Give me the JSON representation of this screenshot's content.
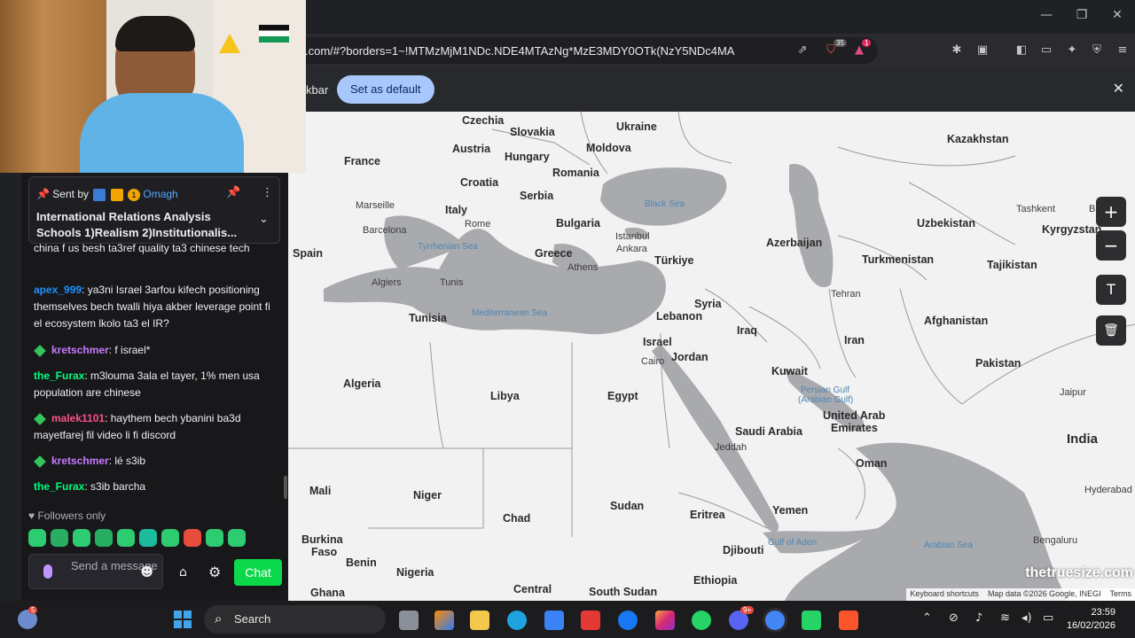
{
  "browser": {
    "url": ".com/#?borders=1~!MTMzMjM1NDc.NDE4MTAzNg*MzE3MDY0OTk(NzY5NDc4MA",
    "infobar_text": "kbar",
    "set_default_label": "Set as default",
    "extension_badges": [
      "35",
      "1"
    ]
  },
  "map": {
    "countries": [
      {
        "name": "Czechia"
      },
      {
        "name": "Ukraine"
      },
      {
        "name": "Slovakia"
      },
      {
        "name": "Moldova"
      },
      {
        "name": "Austria"
      },
      {
        "name": "Hungary"
      },
      {
        "name": "France"
      },
      {
        "name": "Romania"
      },
      {
        "name": "Kazakhstan"
      },
      {
        "name": "Croatia"
      },
      {
        "name": "Serbia"
      },
      {
        "name": "Italy"
      },
      {
        "name": "Bulgaria"
      },
      {
        "name": "Uzbekistan"
      },
      {
        "name": "Kyrgyzstan"
      },
      {
        "name": "Azerbaijan"
      },
      {
        "name": "Spain"
      },
      {
        "name": "Greece"
      },
      {
        "name": "Türkiye"
      },
      {
        "name": "Turkmenistan"
      },
      {
        "name": "Tajikistan"
      },
      {
        "name": "Tunisia"
      },
      {
        "name": "Syria"
      },
      {
        "name": "Lebanon"
      },
      {
        "name": "Iraq"
      },
      {
        "name": "Afghanistan"
      },
      {
        "name": "Israel"
      },
      {
        "name": "Iran"
      },
      {
        "name": "Jordan"
      },
      {
        "name": "Kuwait"
      },
      {
        "name": "Pakistan"
      },
      {
        "name": "Algeria"
      },
      {
        "name": "Libya"
      },
      {
        "name": "Egypt"
      },
      {
        "name": "United Arab"
      },
      {
        "name": "Emirates"
      },
      {
        "name": "Saudi Arabia"
      },
      {
        "name": "India"
      },
      {
        "name": "Oman"
      },
      {
        "name": "Mali"
      },
      {
        "name": "Niger"
      },
      {
        "name": "Chad"
      },
      {
        "name": "Sudan"
      },
      {
        "name": "Eritrea"
      },
      {
        "name": "Yemen"
      },
      {
        "name": "Burkina"
      },
      {
        "name": "Faso"
      },
      {
        "name": "Benin"
      },
      {
        "name": "Nigeria"
      },
      {
        "name": "Djibouti"
      },
      {
        "name": "Ethiopia"
      },
      {
        "name": "Ghana"
      },
      {
        "name": "Central"
      },
      {
        "name": "South Sudan"
      }
    ],
    "cities": [
      {
        "name": "Marseille"
      },
      {
        "name": "Rome"
      },
      {
        "name": "Barcelona"
      },
      {
        "name": "Istanbul"
      },
      {
        "name": "Ankara"
      },
      {
        "name": "Athens"
      },
      {
        "name": "Algiers"
      },
      {
        "name": "Tunis"
      },
      {
        "name": "Tehran"
      },
      {
        "name": "Cairo"
      },
      {
        "name": "Jeddah"
      },
      {
        "name": "Jaipur"
      },
      {
        "name": "Hyderabad"
      },
      {
        "name": "Bengaluru"
      },
      {
        "name": "Tashkent"
      },
      {
        "name": "Bishkek"
      }
    ],
    "seas": [
      {
        "name": "Black Sea"
      },
      {
        "name": "Tyrrhenian Sea"
      },
      {
        "name": "Mediterranean Sea"
      },
      {
        "name": "Persian Gulf"
      },
      {
        "name": "(Arabian Gulf)"
      },
      {
        "name": "Gulf of Aden"
      },
      {
        "name": "Arabian Sea"
      }
    ],
    "controls": {
      "zoom_in": "+",
      "zoom_out": "−",
      "text_tool": "T"
    },
    "watermark": "thetruesize.com",
    "attribution": [
      "Keyboard shortcuts",
      "Map data ©2026 Google, INEGI",
      "Terms"
    ]
  },
  "chat": {
    "pinned": {
      "sent_by": "Sent by",
      "badge_count": "1",
      "user": "Omagh",
      "title": "International Relations Analysis Schools 1)Realism 2)Institutionalis..."
    },
    "messages": [
      {
        "user": "",
        "text": "china f us besh ta3ref quality ta3 chinese tech",
        "color": "#efeff1",
        "sub": false
      },
      {
        "user": "apex_999",
        "text": ": ya3ni Israel 3arfou kifech positioning themselves bech twalli hiya akber leverage point fi el ecosystem lkolo ta3 el IR?",
        "color": "#1e90ff",
        "sub": false
      },
      {
        "user": "kretschmer",
        "text": ": f israel*",
        "color": "#c879ff",
        "sub": true
      },
      {
        "user": "the_Furax",
        "text": ": m3louma 3ala el tayer, 1% men usa population are chinese",
        "color": "#00ff7f",
        "sub": false
      },
      {
        "user": "malek1101",
        "text": ": haythem bech ybanini ba3d mayetfarej fil video li fi discord",
        "color": "#ff4f8b",
        "sub": true
      },
      {
        "user": "kretschmer",
        "text": ": lé s3ib",
        "color": "#c879ff",
        "sub": true
      },
      {
        "user": "the_Furax",
        "text": ": s3ib barcha",
        "color": "#00ff7f",
        "sub": false
      }
    ],
    "followers_only": "Followers only",
    "input_placeholder": "Send a message",
    "chat_button": "Chat"
  },
  "taskbar": {
    "search_placeholder": "Search",
    "time": "23:59",
    "date": "16/02/2026",
    "notif_badge": "5",
    "discord_badge": "9+"
  }
}
